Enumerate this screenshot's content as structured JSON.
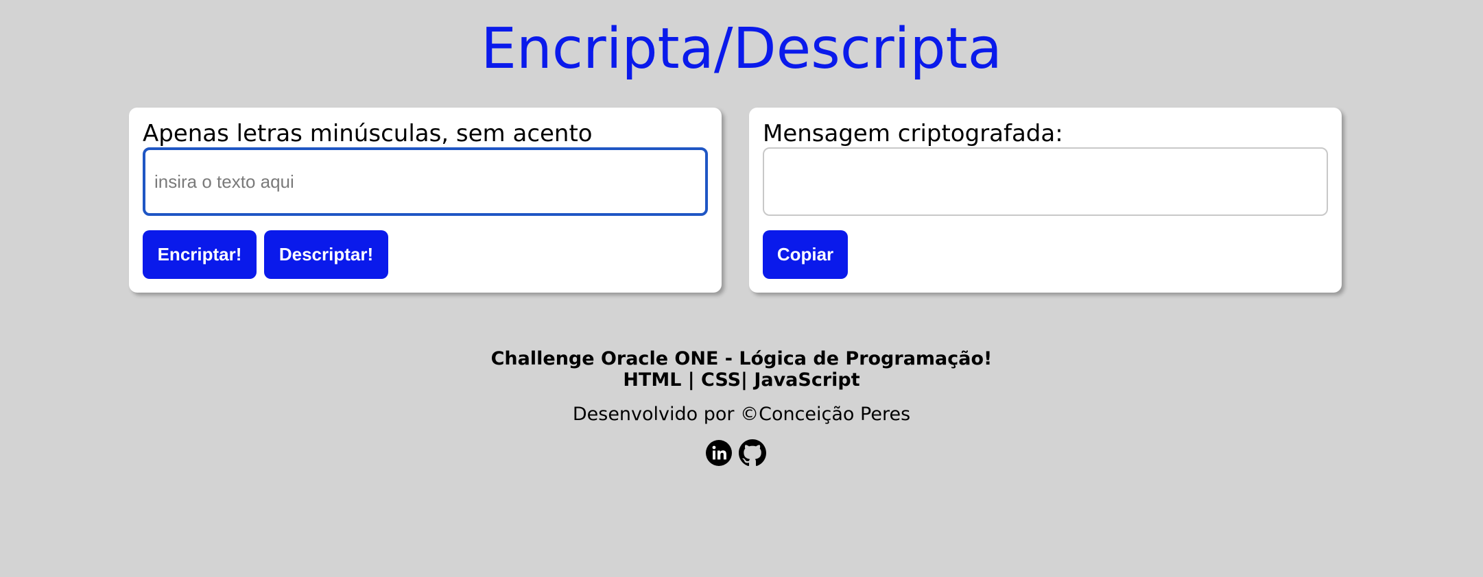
{
  "header": {
    "title": "Encripta/Descripta"
  },
  "encrypt_panel": {
    "label": "Apenas letras minúsculas, sem acento",
    "input_placeholder": "insira o texto aqui",
    "input_value": "",
    "encrypt_button": "Encriptar!",
    "decrypt_button": "Descriptar!"
  },
  "output_panel": {
    "label": "Mensagem criptografada:",
    "output_value": "",
    "copy_button": "Copiar"
  },
  "footer": {
    "line1": "Challenge Oracle ONE - Lógica de Programação!",
    "line2": "HTML | CSS| JavaScript",
    "credit": "Desenvolvido por ©Conceição Peres",
    "social_icons": [
      "linkedin-icon",
      "github-icon"
    ]
  },
  "colors": {
    "background": "#d3d3d3",
    "accent": "#0a1aeb",
    "focus_border": "#1f56c4",
    "card": "#ffffff"
  }
}
